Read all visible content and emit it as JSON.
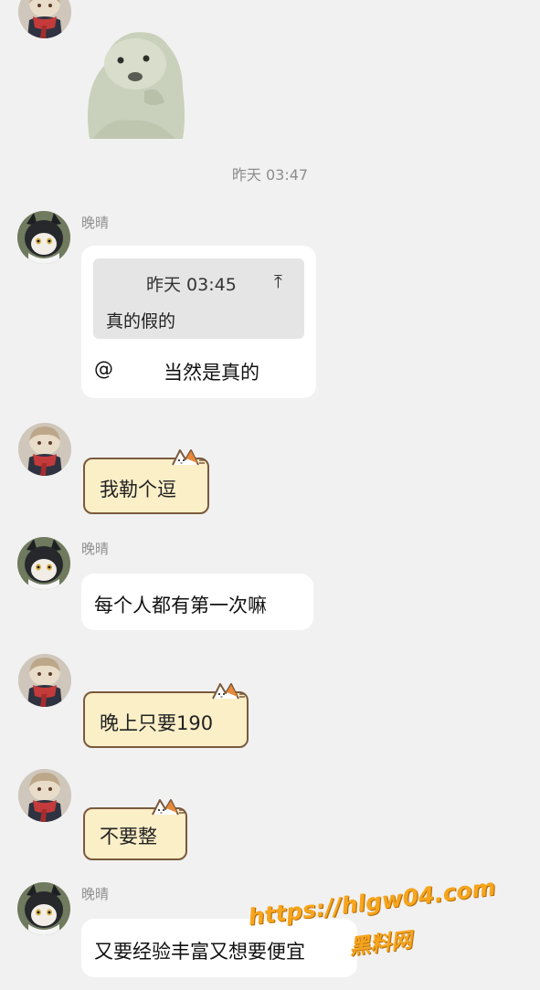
{
  "timestamp_divider": "昨天 03:47",
  "messages": [
    {
      "sender": "",
      "type": "sticker",
      "sticker": "seal-sticker"
    },
    {
      "sender": "晚晴",
      "type": "reply",
      "quote": {
        "time": "昨天 03:45",
        "icon": "⤒",
        "text": "真的假的"
      },
      "mention": "@",
      "text": "当然是真的"
    },
    {
      "sender": "",
      "type": "cat-bubble",
      "text": "我勒个逗"
    },
    {
      "sender": "晚晴",
      "type": "text",
      "text": "每个人都有第一次嘛"
    },
    {
      "sender": "",
      "type": "cat-bubble",
      "text": "晚上只要190"
    },
    {
      "sender": "",
      "type": "cat-bubble",
      "text": "不要整"
    },
    {
      "sender": "晚晴",
      "type": "text",
      "text": "又要经验丰富又想要便宜"
    }
  ],
  "watermark": {
    "line1": "https://hlgw04.com",
    "line2": "黑料网"
  },
  "colors": {
    "background": "#f1f1f1",
    "bubble": "#ffffff",
    "quote_bg": "#e5e5e5",
    "cat_bubble_fill": "#fbefc8",
    "cat_bubble_border": "#7a5a3c",
    "watermark": "#f6a51d"
  }
}
